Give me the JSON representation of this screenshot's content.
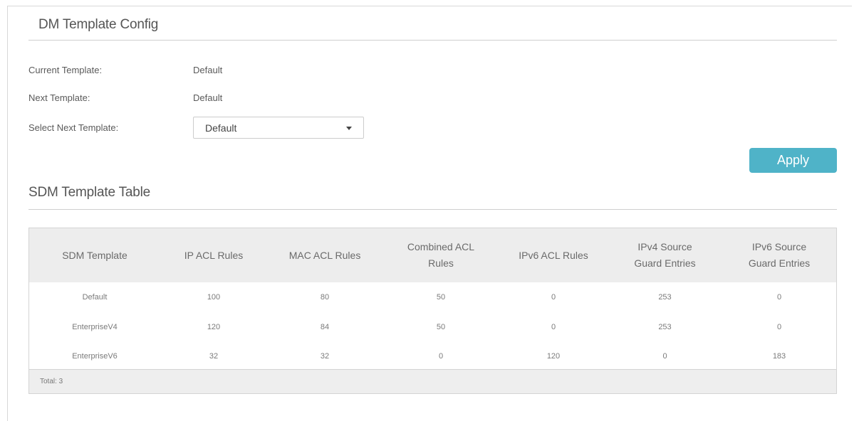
{
  "config_section": {
    "title": "DM Template Config"
  },
  "current_template": {
    "label": "Current Template:",
    "value": "Default"
  },
  "next_template": {
    "label": "Next Template:",
    "value": "Default"
  },
  "select_next_template": {
    "label": "Select Next Template:",
    "selected": "Default",
    "icon": "chevron-down-icon"
  },
  "apply_button": {
    "label": "Apply",
    "color": "#4fb3c8"
  },
  "table_section": {
    "title": "SDM Template Table"
  },
  "table": {
    "headers": [
      [
        "SDM Template"
      ],
      [
        "IP ACL Rules"
      ],
      [
        "MAC ACL Rules"
      ],
      [
        "Combined ACL",
        "Rules"
      ],
      [
        "IPv6 ACL Rules"
      ],
      [
        "IPv4 Source",
        "Guard Entries"
      ],
      [
        "IPv6 Source",
        "Guard Entries"
      ]
    ],
    "rows": [
      [
        "Default",
        "100",
        "80",
        "50",
        "0",
        "253",
        "0"
      ],
      [
        "EnterpriseV4",
        "120",
        "84",
        "50",
        "0",
        "253",
        "0"
      ],
      [
        "EnterpriseV6",
        "32",
        "32",
        "0",
        "120",
        "0",
        "183"
      ]
    ],
    "footer": "Total: 3"
  }
}
